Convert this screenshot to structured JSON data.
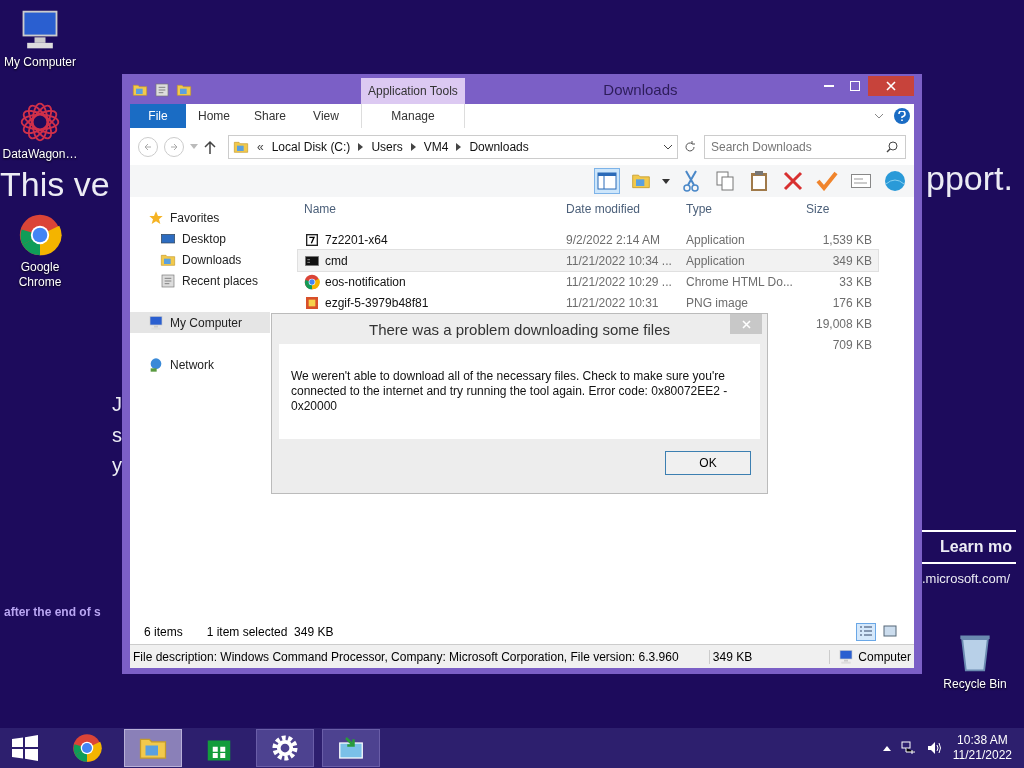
{
  "desktop": {
    "background_text": [
      {
        "kind": "headline",
        "text": "This ve"
      },
      {
        "kind": "headline",
        "text": "pport."
      },
      {
        "kind": "body",
        "text": "J"
      },
      {
        "kind": "body",
        "text": "s"
      },
      {
        "kind": "body",
        "text": "y"
      },
      {
        "kind": "note",
        "text": "after the end of s"
      },
      {
        "kind": "link-button",
        "text": "Learn mo"
      },
      {
        "kind": "url",
        "text": ".microsoft.com/"
      }
    ],
    "icons": [
      {
        "kind": "computer",
        "label": "My Computer"
      },
      {
        "kind": "star-shortcut",
        "label": "DataWagon…"
      },
      {
        "kind": "chrome",
        "label": "Google Chrome"
      },
      {
        "kind": "recycle",
        "label": "Recycle Bin"
      }
    ]
  },
  "explorer": {
    "title": "Downloads",
    "context_tab": "Application Tools",
    "ribbon_tabs": [
      {
        "kind": "file",
        "label": "File"
      },
      {
        "kind": "normal",
        "label": "Home"
      },
      {
        "kind": "normal",
        "label": "Share"
      },
      {
        "kind": "normal",
        "label": "View"
      },
      {
        "kind": "context",
        "label": "Manage"
      }
    ],
    "address": {
      "overflow": "«",
      "crumbs": [
        "Local Disk (C:)",
        "Users",
        "VM4",
        "Downloads"
      ]
    },
    "search": {
      "placeholder": "Search Downloads"
    },
    "nav": [
      {
        "kind": "star",
        "label": "Favorites",
        "selected": false,
        "children": [
          {
            "kind": "desktop",
            "label": "Desktop",
            "selected": false
          },
          {
            "kind": "folder",
            "label": "Downloads",
            "selected": false
          },
          {
            "kind": "recent",
            "label": "Recent places",
            "selected": false
          }
        ]
      },
      {
        "kind": "computer",
        "label": "My Computer",
        "selected": true
      },
      {
        "kind": "network",
        "label": "Network",
        "selected": false
      }
    ],
    "columns": [
      "Name",
      "Date modified",
      "Type",
      "Size"
    ],
    "rows": [
      {
        "kind": "archive",
        "name": "7z2201-x64",
        "date": "9/2/2022 2:14 AM",
        "type": "Application",
        "size": "1,539 KB",
        "selected": false
      },
      {
        "kind": "console",
        "name": "cmd",
        "date": "11/21/2022 10:34 ...",
        "type": "Application",
        "size": "349 KB",
        "selected": true
      },
      {
        "kind": "chrome",
        "name": "eos-notification",
        "date": "11/21/2022 10:29 ...",
        "type": "Chrome HTML Do...",
        "size": "33 KB",
        "selected": false
      },
      {
        "kind": "image",
        "name": "ezgif-5-3979b48f81",
        "date": "11/21/2022 10:31",
        "type": "PNG image",
        "size": "176 KB",
        "selected": false
      },
      {
        "kind": "hidden",
        "size": "19,008 KB",
        "selected": false
      },
      {
        "kind": "hidden",
        "size": "709 KB",
        "selected": false
      }
    ],
    "status": {
      "count": "6 items",
      "selection": "1 item selected  349 KB"
    },
    "details": {
      "description": "File description: Windows Command Processor, Company: Microsoft Corporation, File version: 6.3.960",
      "size": "349 KB",
      "location": "Computer"
    }
  },
  "dialog": {
    "title": "There was a problem downloading some files",
    "message": "We weren't able to download all of the necessary files. Check to make sure you're connected to the internet and try running the tool again. Error code: 0x80072EE2 - 0x20000",
    "button": "OK"
  },
  "taskbar": {
    "apps": [
      {
        "kind": "chrome",
        "selected": false,
        "open": false
      },
      {
        "kind": "explorer",
        "selected": true,
        "open": true
      },
      {
        "kind": "store",
        "selected": false,
        "open": false
      },
      {
        "kind": "settings",
        "selected": false,
        "open": true
      },
      {
        "kind": "installer",
        "selected": false,
        "open": true
      }
    ],
    "time": "10:38 AM",
    "date": "11/21/2022"
  }
}
